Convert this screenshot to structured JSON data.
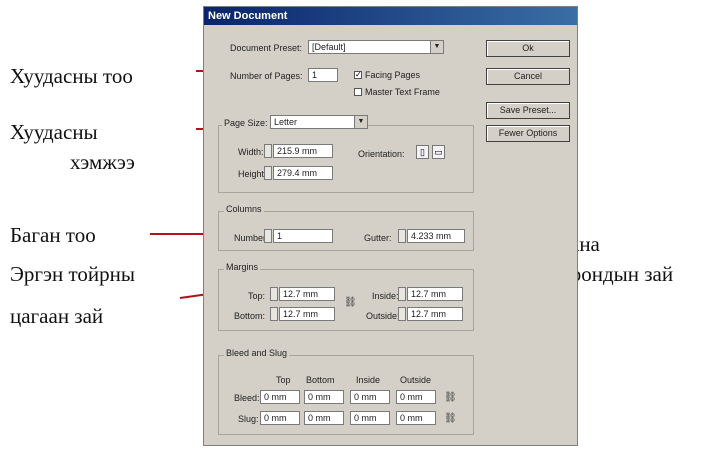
{
  "annotations": {
    "pages_count": "Хуудасны тоо",
    "page_size_line1": "Хуудасны",
    "page_size_line2": "хэмжээ",
    "columns_count": "Баган тоо",
    "margins_line1": "Эргэн тойрны",
    "margins_line2": "цагаан зай",
    "gutter_line1": "Багана",
    "gutter_line2": "хоорондын зай"
  },
  "dialog": {
    "title": "New Document",
    "document_preset_label": "Document Preset:",
    "document_preset_value": "[Default]",
    "number_of_pages_label": "Number of Pages:",
    "number_of_pages_value": "1",
    "facing_pages_label": "Facing Pages",
    "facing_pages_checked": true,
    "master_text_frame_label": "Master Text Frame",
    "master_text_frame_checked": false,
    "page_size_label": "Page Size:",
    "page_size_value": "Letter",
    "width_label": "Width:",
    "width_value": "215.9 mm",
    "height_label": "Height:",
    "height_value": "279.4 mm",
    "orientation_label": "Orientation:",
    "columns_title": "Columns",
    "number_label": "Number:",
    "number_value": "1",
    "gutter_label": "Gutter:",
    "gutter_value": "4.233 mm",
    "margins_title": "Margins",
    "top_label": "Top:",
    "top_value": "12.7 mm",
    "bottom_label": "Bottom:",
    "bottom_value": "12.7 mm",
    "inside_label": "Inside:",
    "inside_value": "12.7 mm",
    "outside_label": "Outside:",
    "outside_value": "12.7 mm",
    "bleed_slug_title": "Bleed and Slug",
    "col_top": "Top",
    "col_bottom": "Bottom",
    "col_inside": "Inside",
    "col_outside": "Outside",
    "bleed_label": "Bleed:",
    "slug_label": "Slug:",
    "bleed_values": [
      "0 mm",
      "0 mm",
      "0 mm",
      "0 mm"
    ],
    "slug_values": [
      "0 mm",
      "0 mm",
      "0 mm",
      "0 mm"
    ]
  },
  "buttons": {
    "ok": "Ok",
    "cancel": "Cancel",
    "save_preset": "Save Preset...",
    "fewer_options": "Fewer Options"
  }
}
